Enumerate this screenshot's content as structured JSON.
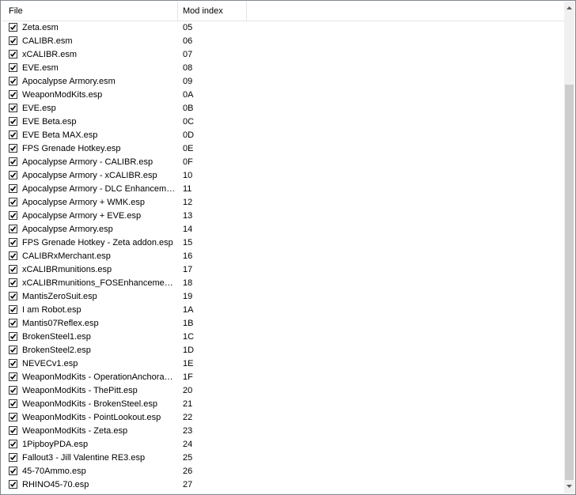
{
  "columns": {
    "file": "File",
    "mod_index": "Mod index"
  },
  "scrollbar": {
    "position": 0.15,
    "visible_fraction": 0.85
  },
  "mods": [
    {
      "file": "Zeta.esm",
      "index": "05",
      "checked": true
    },
    {
      "file": "CALIBR.esm",
      "index": "06",
      "checked": true
    },
    {
      "file": "xCALIBR.esm",
      "index": "07",
      "checked": true
    },
    {
      "file": "EVE.esm",
      "index": "08",
      "checked": true
    },
    {
      "file": "Apocalypse Armory.esm",
      "index": "09",
      "checked": true
    },
    {
      "file": "WeaponModKits.esp",
      "index": "0A",
      "checked": true
    },
    {
      "file": "EVE.esp",
      "index": "0B",
      "checked": true
    },
    {
      "file": "EVE Beta.esp",
      "index": "0C",
      "checked": true
    },
    {
      "file": "EVE Beta MAX.esp",
      "index": "0D",
      "checked": true
    },
    {
      "file": "FPS Grenade Hotkey.esp",
      "index": "0E",
      "checked": true
    },
    {
      "file": "Apocalypse Armory - CALIBR.esp",
      "index": "0F",
      "checked": true
    },
    {
      "file": "Apocalypse Armory - xCALIBR.esp",
      "index": "10",
      "checked": true
    },
    {
      "file": "Apocalypse Armory - DLC Enhancemen...",
      "index": "11",
      "checked": true
    },
    {
      "file": "Apocalypse Armory + WMK.esp",
      "index": "12",
      "checked": true
    },
    {
      "file": "Apocalypse Armory + EVE.esp",
      "index": "13",
      "checked": true
    },
    {
      "file": "Apocalypse Armory.esp",
      "index": "14",
      "checked": true
    },
    {
      "file": "FPS Grenade Hotkey - Zeta addon.esp",
      "index": "15",
      "checked": true
    },
    {
      "file": "CALIBRxMerchant.esp",
      "index": "16",
      "checked": true
    },
    {
      "file": "xCALIBRmunitions.esp",
      "index": "17",
      "checked": true
    },
    {
      "file": "xCALIBRmunitions_FOSEnhancements...",
      "index": "18",
      "checked": true
    },
    {
      "file": "MantisZeroSuit.esp",
      "index": "19",
      "checked": true
    },
    {
      "file": "I am Robot.esp",
      "index": "1A",
      "checked": true
    },
    {
      "file": "Mantis07Reflex.esp",
      "index": "1B",
      "checked": true
    },
    {
      "file": "BrokenSteel1.esp",
      "index": "1C",
      "checked": true
    },
    {
      "file": "BrokenSteel2.esp",
      "index": "1D",
      "checked": true
    },
    {
      "file": "NEVECv1.esp",
      "index": "1E",
      "checked": true
    },
    {
      "file": "WeaponModKits - OperationAnchorage...",
      "index": "1F",
      "checked": true
    },
    {
      "file": "WeaponModKits - ThePitt.esp",
      "index": "20",
      "checked": true
    },
    {
      "file": "WeaponModKits - BrokenSteel.esp",
      "index": "21",
      "checked": true
    },
    {
      "file": "WeaponModKits - PointLookout.esp",
      "index": "22",
      "checked": true
    },
    {
      "file": "WeaponModKits - Zeta.esp",
      "index": "23",
      "checked": true
    },
    {
      "file": "1PipboyPDA.esp",
      "index": "24",
      "checked": true
    },
    {
      "file": "Fallout3 - Jill Valentine RE3.esp",
      "index": "25",
      "checked": true
    },
    {
      "file": "45-70Ammo.esp",
      "index": "26",
      "checked": true
    },
    {
      "file": "RHINO45-70.esp",
      "index": "27",
      "checked": true
    }
  ]
}
